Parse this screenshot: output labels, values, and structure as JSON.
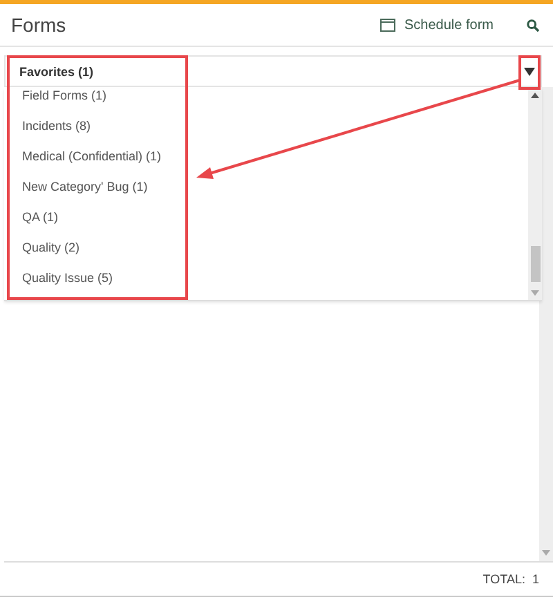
{
  "header": {
    "title": "Forms",
    "schedule_button": "Schedule form"
  },
  "category_select": {
    "value": "Favorites (1)",
    "expanded": true
  },
  "dropdown_items": [
    {
      "label": "Field Forms (1)",
      "selected": false
    },
    {
      "label": "Incidents (8)",
      "selected": false
    },
    {
      "label": "Medical (Confidential) (1)",
      "selected": false
    },
    {
      "label": "New Category' Bug (1)",
      "selected": false
    },
    {
      "label": "QA (1)",
      "selected": false
    },
    {
      "label": "Quality (2)",
      "selected": false
    },
    {
      "label": "Quality Issue (5)",
      "selected": false
    }
  ],
  "footer": {
    "total_label": "TOTAL:",
    "total_value": "1"
  }
}
